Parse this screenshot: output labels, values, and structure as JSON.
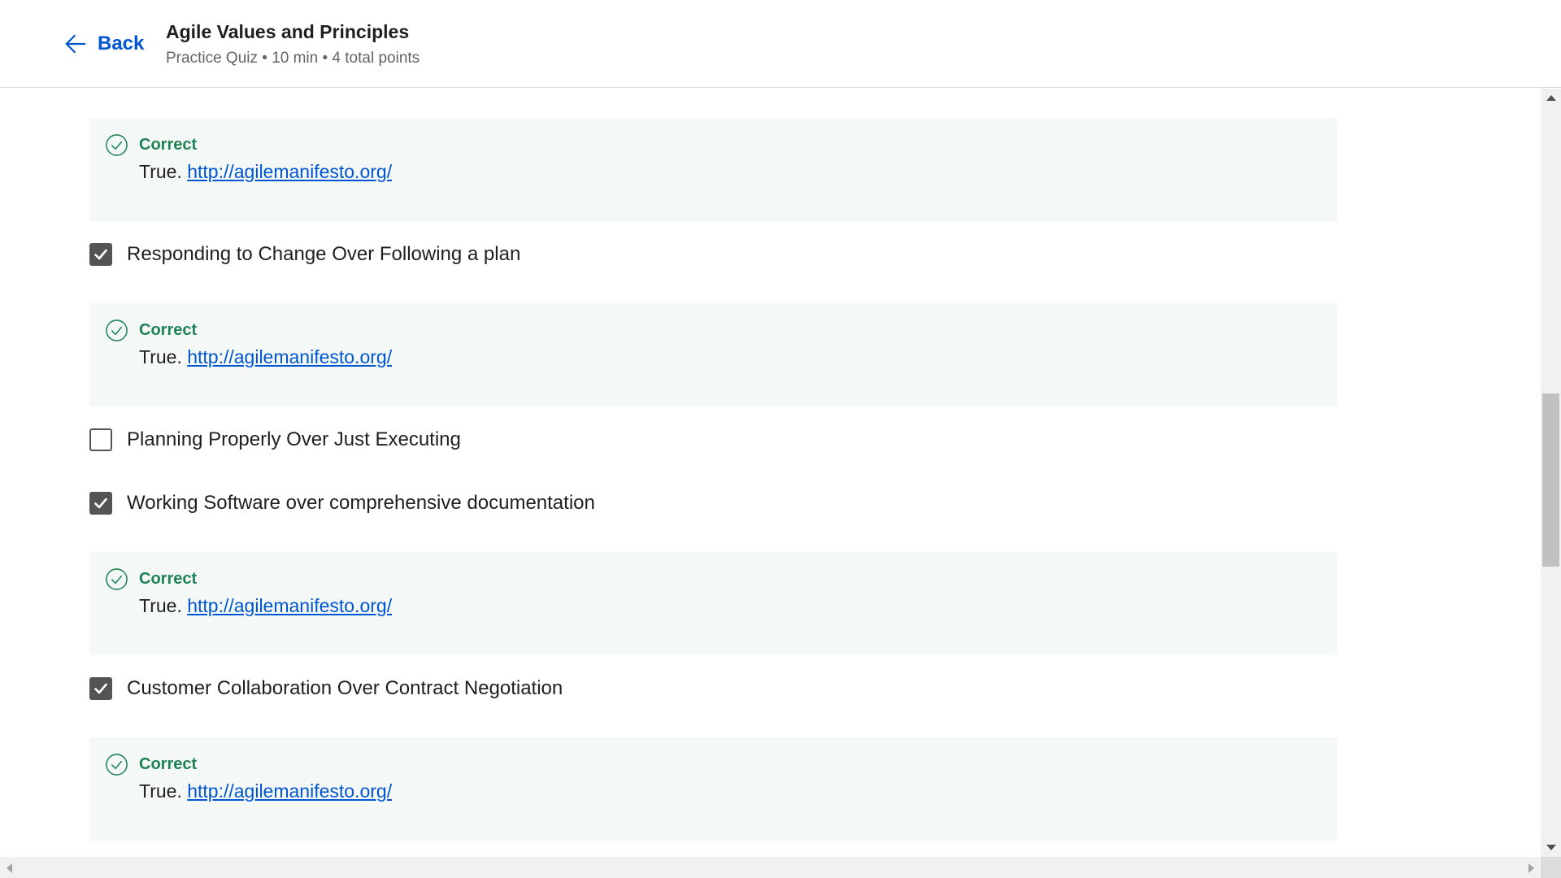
{
  "header": {
    "back_label": "Back",
    "title": "Agile Values and Principles",
    "subtitle": "Practice Quiz • 10 min • 4 total points"
  },
  "colors": {
    "accent": "#0056d2",
    "correct": "#1f8354",
    "feedback_bg": "#f4f8f7",
    "checkbox": "#545454"
  },
  "feedback": {
    "label": "Correct",
    "prefix": "True.",
    "link_text": "http://agilemanifesto.org/"
  },
  "options": [
    {
      "label": "Responding to Change Over Following a plan",
      "checked": true
    },
    {
      "label": "Planning Properly Over Just Executing",
      "checked": false
    },
    {
      "label": "Working Software over comprehensive documentation",
      "checked": true
    },
    {
      "label": "Customer Collaboration Over Contract Negotiation",
      "checked": true
    }
  ]
}
